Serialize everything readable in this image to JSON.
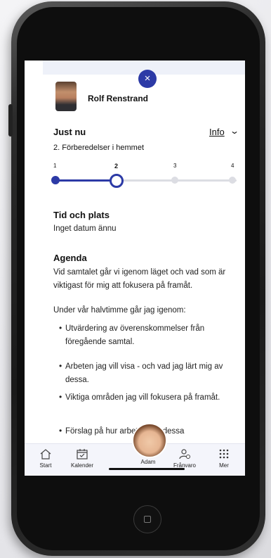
{
  "header": {
    "close_glyph": "×",
    "contact_name": "Rolf Renstrand"
  },
  "status": {
    "title": "Just nu",
    "info_label": "Info",
    "current_step": "2. Förberedelser i hemmet",
    "steps": [
      "1",
      "2",
      "3",
      "4"
    ],
    "active_step": 2,
    "accent_color": "#2c3aa6"
  },
  "time_place": {
    "title": "Tid och plats",
    "value": "Inget datum ännu"
  },
  "agenda": {
    "title": "Agenda",
    "paragraph1": "Vid samtalet går vi igenom läget och vad som är viktigast för mig att fokusera på framåt.",
    "paragraph2": "Under vår halvtimme går jag igenom:",
    "bullets": [
      "Utvärdering av överenskommelser från föregående samtal.",
      "Arbeten jag vill visa - och vad jag lärt mig av dessa.",
      "Viktiga områden jag vill fokusera på framåt.",
      "Förslag på hur        arbeta med dessa"
    ]
  },
  "nav": {
    "start": "Start",
    "kalender": "Kalender",
    "profile": "Adam",
    "franvaro": "Frånvaro",
    "mer": "Mer"
  }
}
